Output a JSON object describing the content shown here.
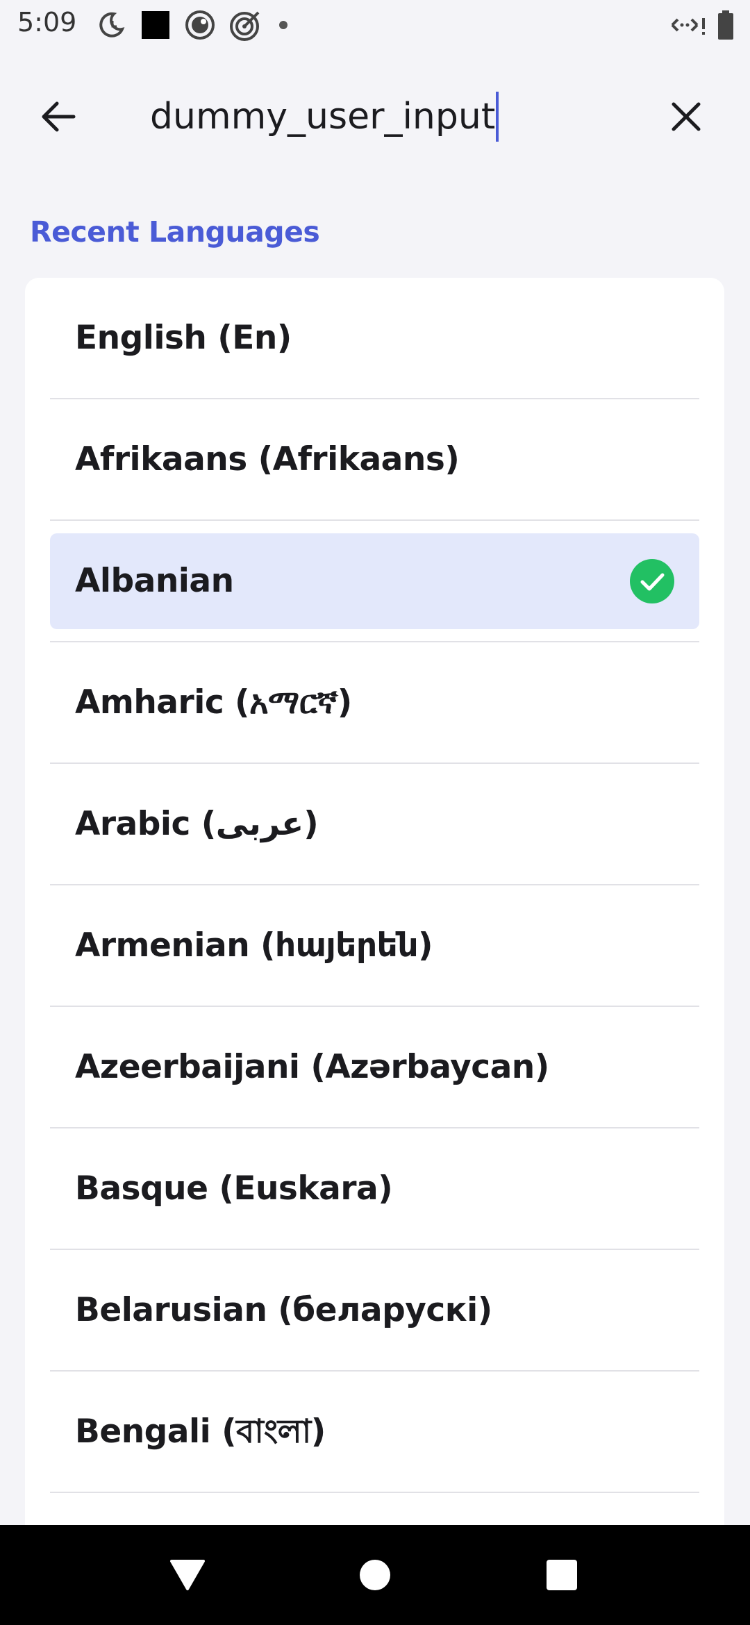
{
  "status_bar": {
    "time": "5:09",
    "left_icons": [
      "moon-clock-icon",
      "black-square-icon",
      "circle-dot-icon",
      "target-icon",
      "dot-icon"
    ],
    "right_icons": [
      "data-arrows-icon",
      "battery-icon"
    ]
  },
  "search": {
    "value": "dummy_user_input",
    "back_icon": "arrow-left-icon",
    "clear_icon": "close-icon"
  },
  "section": {
    "title": "Recent Languages"
  },
  "languages": [
    {
      "label": "English (En)",
      "selected": false
    },
    {
      "label": "Afrikaans (Afrikaans)",
      "selected": false
    },
    {
      "label": "Albanian",
      "selected": true
    },
    {
      "label": "Amharic (አማርኛ)",
      "selected": false
    },
    {
      "label": "Arabic (عربى)",
      "selected": false
    },
    {
      "label": "Armenian (հայերեն)",
      "selected": false
    },
    {
      "label": "Azeerbaijani (Azərbaycan)",
      "selected": false
    },
    {
      "label": "Basque (Euskara)",
      "selected": false
    },
    {
      "label": "Belarusian (беларускі)",
      "selected": false
    },
    {
      "label": "Bengali (বাংলা)",
      "selected": false
    }
  ],
  "colors": {
    "accent": "#4a5bd6",
    "selected_bg": "#e3e8fb",
    "check_green": "#22c063"
  },
  "nav": {
    "icons": [
      "back-triangle-icon",
      "home-circle-icon",
      "recents-square-icon"
    ]
  }
}
